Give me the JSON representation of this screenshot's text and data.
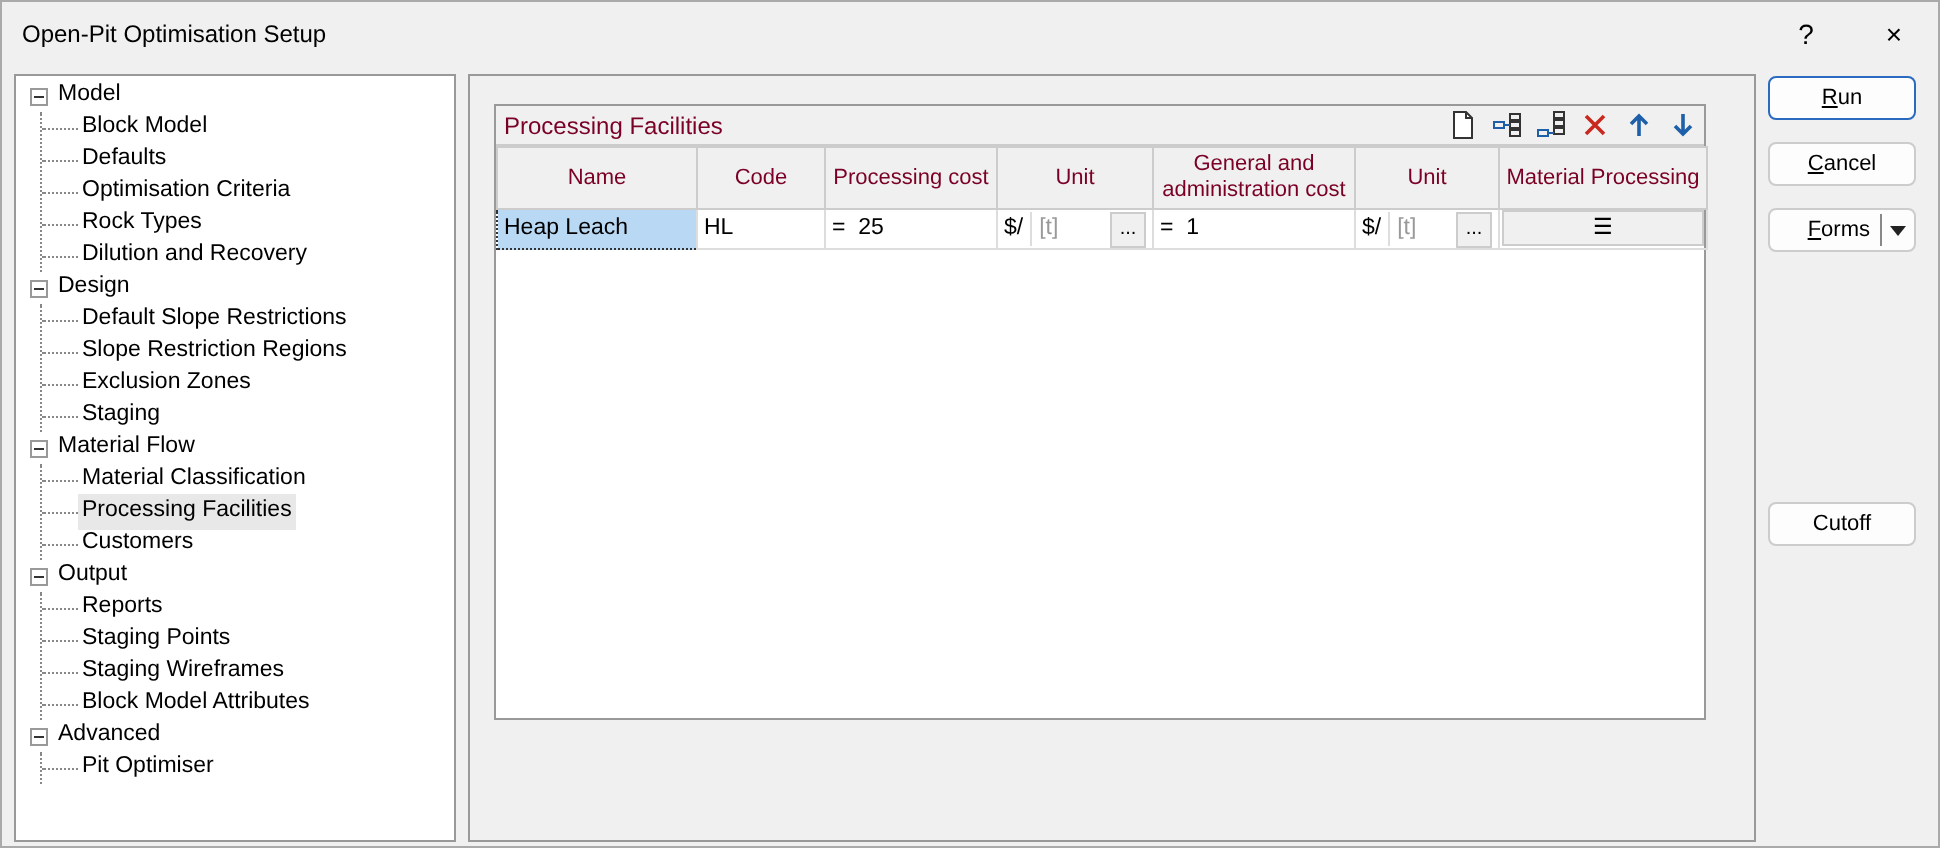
{
  "window": {
    "title": "Open-Pit Optimisation Setup",
    "help": "?",
    "close": "×"
  },
  "tree": [
    {
      "label": "Model",
      "expanded": true,
      "children": [
        {
          "label": "Block Model",
          "selected": false
        },
        {
          "label": "Defaults",
          "selected": false
        },
        {
          "label": "Optimisation Criteria",
          "selected": false
        },
        {
          "label": "Rock Types",
          "selected": false
        },
        {
          "label": "Dilution and Recovery",
          "selected": false
        }
      ]
    },
    {
      "label": "Design",
      "expanded": true,
      "children": [
        {
          "label": "Default Slope Restrictions",
          "selected": false
        },
        {
          "label": "Slope Restriction Regions",
          "selected": false
        },
        {
          "label": "Exclusion Zones",
          "selected": false
        },
        {
          "label": "Staging",
          "selected": false
        }
      ]
    },
    {
      "label": "Material Flow",
      "expanded": true,
      "children": [
        {
          "label": "Material Classification",
          "selected": false
        },
        {
          "label": "Processing Facilities",
          "selected": true
        },
        {
          "label": "Customers",
          "selected": false
        }
      ]
    },
    {
      "label": "Output",
      "expanded": true,
      "children": [
        {
          "label": "Reports",
          "selected": false
        },
        {
          "label": "Staging Points",
          "selected": false
        },
        {
          "label": "Staging Wireframes",
          "selected": false
        },
        {
          "label": "Block Model Attributes",
          "selected": false
        }
      ]
    },
    {
      "label": "Advanced",
      "expanded": true,
      "children": [
        {
          "label": "Pit Optimiser",
          "selected": false
        }
      ]
    }
  ],
  "grid": {
    "title": "Processing Facilities",
    "toolbar": [
      {
        "kind": "new"
      },
      {
        "kind": "insert"
      },
      {
        "kind": "append"
      },
      {
        "kind": "delete"
      },
      {
        "kind": "up"
      },
      {
        "kind": "down"
      }
    ],
    "columns": [
      "Name",
      "Code",
      "Processing cost",
      "Unit",
      "General and administration cost",
      "Unit",
      "Material Processing"
    ],
    "rows": [
      {
        "selected": true,
        "name": "Heap Leach",
        "code": "HL",
        "processing_cost": {
          "op": "=",
          "value": "25"
        },
        "unit_1": {
          "prefix": "$/",
          "placeholder": "[t]",
          "button": "..."
        },
        "ga_cost": {
          "op": "=",
          "value": "1"
        },
        "unit_2": {
          "prefix": "$/",
          "placeholder": "[t]",
          "button": "..."
        },
        "material_processing": "☰"
      }
    ]
  },
  "buttons": [
    {
      "label": "Run",
      "mnemonic": true,
      "kind": "default"
    },
    {
      "label": "Cancel",
      "mnemonic": true,
      "kind": "plain"
    },
    {
      "label": "Forms",
      "mnemonic": true,
      "kind": "split"
    },
    {
      "label": "Cutoff",
      "mnemonic": false,
      "kind": "plain"
    }
  ]
}
